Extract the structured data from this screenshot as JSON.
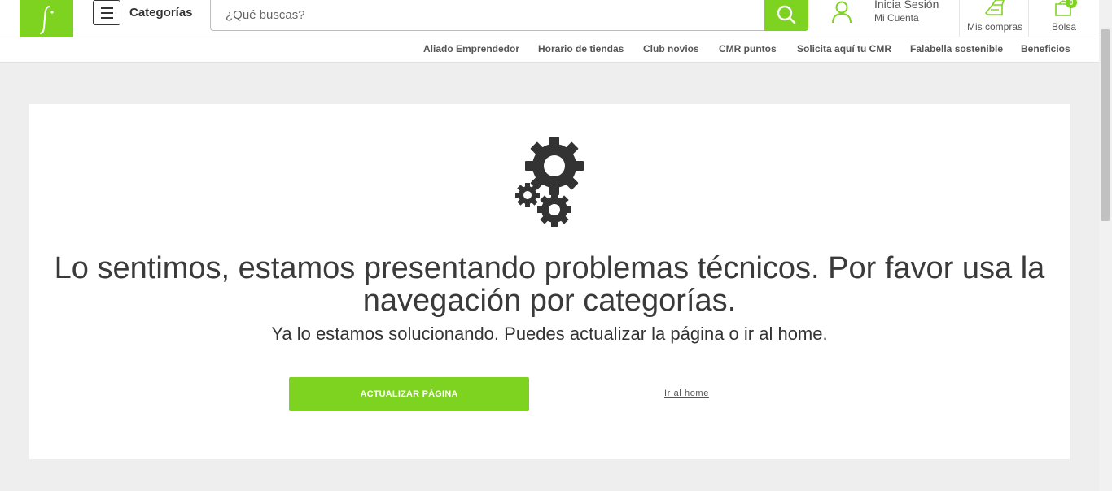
{
  "header": {
    "menu_label": "Categorías",
    "search": {
      "placeholder": "¿Qué buscas?"
    },
    "account": {
      "title": "Inicia Sesión",
      "subtitle": "Mi Cuenta"
    },
    "purchases_label": "Mis compras",
    "bag": {
      "label": "Bolsa",
      "count": "0"
    }
  },
  "subnav": {
    "links": [
      "Aliado Emprendedor",
      "Horario de tiendas",
      "Club novios",
      "CMR puntos",
      "Solicita aquí tu CMR",
      "Falabella sostenible",
      "Beneficios"
    ]
  },
  "error": {
    "icon": "gears-icon",
    "title": "Lo sentimos, estamos presentando problemas técnicos. Por favor usa la navegación por categorías.",
    "subtitle": "Ya lo estamos solucionando. Puedes actualizar la página o ir al home.",
    "refresh_button": "ACTUALIZAR PÁGINA",
    "home_link": "Ir al home"
  },
  "colors": {
    "brand_green": "#7ed321",
    "page_background": "#eeeeee",
    "text_dark": "#333333"
  }
}
